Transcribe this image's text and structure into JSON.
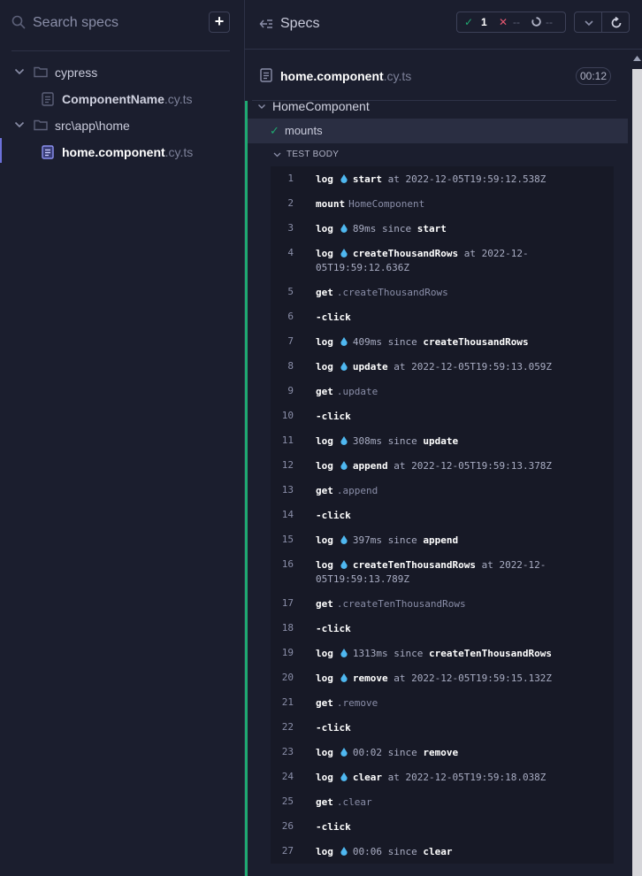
{
  "sidebar": {
    "search_placeholder": "Search specs",
    "add_label": "+",
    "tree": [
      {
        "type": "folder",
        "label": "cypress"
      },
      {
        "type": "file",
        "name": "ComponentName",
        "ext": ".cy.ts"
      },
      {
        "type": "folder",
        "label": "src\\app\\home"
      },
      {
        "type": "file",
        "name": "home.component",
        "ext": ".cy.ts",
        "active": true
      }
    ]
  },
  "header": {
    "title": "Specs",
    "stats": {
      "passed": "1",
      "failed": "--",
      "pending": "--"
    }
  },
  "spec": {
    "name": "home.component",
    "ext": ".cy.ts",
    "duration": "00:12",
    "suite": "HomeComponent",
    "test": "mounts",
    "section_label": "TEST BODY"
  },
  "commands": [
    {
      "n": "1",
      "name": "log",
      "info": true,
      "msg": [
        "b:start",
        " at 2022-12-05T19:59:12.538Z"
      ]
    },
    {
      "n": "2",
      "name": "mount",
      "sel": "HomeComponent"
    },
    {
      "n": "3",
      "name": "log",
      "info": true,
      "msg": [
        "89ms since ",
        "b:start"
      ]
    },
    {
      "n": "4",
      "name": "log",
      "info": true,
      "tall": true,
      "msg": [
        "b:createThousandRows",
        " at 2022-12-05T19:59:12.636Z"
      ]
    },
    {
      "n": "5",
      "name": "get",
      "sel": ".createThousandRows"
    },
    {
      "n": "6",
      "child": "-click"
    },
    {
      "n": "7",
      "name": "log",
      "info": true,
      "msg": [
        "409ms since ",
        "b:createThousandRows"
      ]
    },
    {
      "n": "8",
      "name": "log",
      "info": true,
      "msg": [
        "b:update",
        " at 2022-12-05T19:59:13.059Z"
      ]
    },
    {
      "n": "9",
      "name": "get",
      "sel": ".update"
    },
    {
      "n": "10",
      "child": "-click"
    },
    {
      "n": "11",
      "name": "log",
      "info": true,
      "msg": [
        "308ms since ",
        "b:update"
      ]
    },
    {
      "n": "12",
      "name": "log",
      "info": true,
      "msg": [
        "b:append",
        " at 2022-12-05T19:59:13.378Z"
      ]
    },
    {
      "n": "13",
      "name": "get",
      "sel": ".append"
    },
    {
      "n": "14",
      "child": "-click"
    },
    {
      "n": "15",
      "name": "log",
      "info": true,
      "msg": [
        "397ms since ",
        "b:append"
      ]
    },
    {
      "n": "16",
      "name": "log",
      "info": true,
      "tall": true,
      "msg": [
        "b:createTenThousandRows",
        " at 2022-12-05T19:59:13.789Z"
      ]
    },
    {
      "n": "17",
      "name": "get",
      "sel": ".createTenThousandRows"
    },
    {
      "n": "18",
      "child": "-click"
    },
    {
      "n": "19",
      "name": "log",
      "info": true,
      "msg": [
        "1313ms since ",
        "b:createTenThousandRows"
      ]
    },
    {
      "n": "20",
      "name": "log",
      "info": true,
      "msg": [
        "b:remove",
        " at 2022-12-05T19:59:15.132Z"
      ]
    },
    {
      "n": "21",
      "name": "get",
      "sel": ".remove"
    },
    {
      "n": "22",
      "child": "-click"
    },
    {
      "n": "23",
      "name": "log",
      "info": true,
      "msg": [
        "00:02 since ",
        "b:remove"
      ]
    },
    {
      "n": "24",
      "name": "log",
      "info": true,
      "msg": [
        "b:clear",
        " at 2022-12-05T19:59:18.038Z"
      ]
    },
    {
      "n": "25",
      "name": "get",
      "sel": ".clear"
    },
    {
      "n": "26",
      "child": "-click"
    },
    {
      "n": "27",
      "name": "log",
      "info": true,
      "msg": [
        "00:06 since ",
        "b:clear"
      ]
    }
  ],
  "colors": {
    "background": "#1b1e2e",
    "passed": "#1fa971",
    "failed": "#e45770",
    "accent": "#6c71d9",
    "info_icon": "#4fb8f0"
  },
  "icons": [
    "search-icon",
    "plus-icon",
    "chevron-down-icon",
    "folder-icon",
    "document-icon",
    "collapse-left-icon",
    "check-icon",
    "close-icon",
    "pending-icon",
    "refresh-icon",
    "info-drop-icon",
    "scroll-up-icon"
  ]
}
